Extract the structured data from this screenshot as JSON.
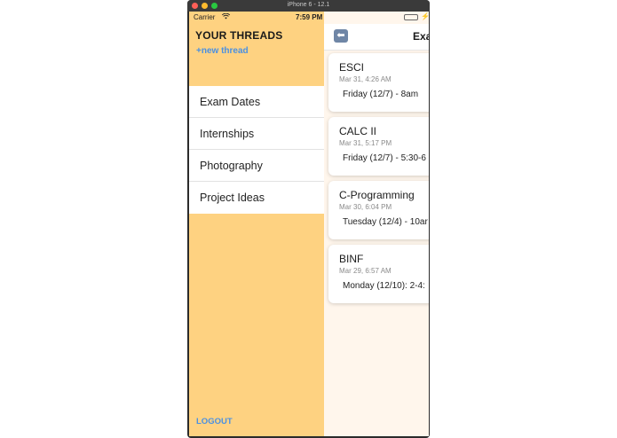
{
  "simulator": {
    "window_title": "iPhone 6 - 12.1"
  },
  "status_bar": {
    "carrier": "Carrier",
    "time": "7:59 PM",
    "battery_percent": 100
  },
  "sidebar": {
    "title": "YOUR THREADS",
    "new_thread_label": "+new thread",
    "items": [
      {
        "label": "Exam Dates"
      },
      {
        "label": "Internships"
      },
      {
        "label": "Photography"
      },
      {
        "label": "Project Ideas"
      }
    ],
    "logout_label": "LOGOUT"
  },
  "main": {
    "title": "Exa",
    "cards": [
      {
        "title": "ESCI",
        "date": "Mar 31, 4:26 AM",
        "body": "Friday (12/7) - 8am"
      },
      {
        "title": "CALC II",
        "date": "Mar 31, 5:17 PM",
        "body": "Friday (12/7) - 5:30-6"
      },
      {
        "title": "C-Programming",
        "date": "Mar 30, 6:04 PM",
        "body": "Tuesday (12/4) - 10ar"
      },
      {
        "title": "BINF",
        "date": "Mar 29, 6:57 AM",
        "body": "Monday (12/10): 2-4:"
      }
    ]
  },
  "colors": {
    "sidebar_bg": "#fed281",
    "accent_blue": "#4a90e2",
    "main_bg": "#fff6ec"
  }
}
